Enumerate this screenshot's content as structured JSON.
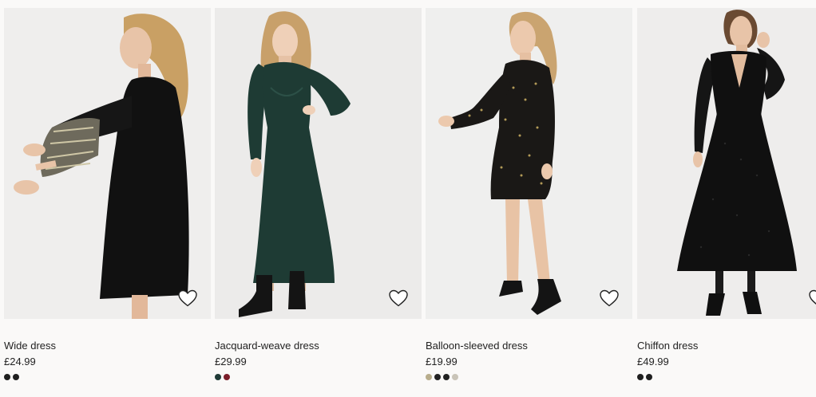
{
  "products": [
    {
      "name": "Wide dress",
      "price": "£24.99",
      "swatches": [
        "#1f1f1f",
        "#1f1f1f"
      ],
      "dress_color": "#111111",
      "bg_color": "#efeeed"
    },
    {
      "name": "Jacquard-weave dress",
      "price": "£29.99",
      "swatches": [
        "#1f3b37",
        "#7b1e2a"
      ],
      "dress_color": "#1e3b34",
      "bg_color": "#ecebea"
    },
    {
      "name": "Balloon-sleeved dress",
      "price": "£19.99",
      "swatches": [
        "#b8ad8c",
        "#222222",
        "#222222",
        "#c9c4b8"
      ],
      "dress_color": "#1a1816",
      "bg_color": "#efefee"
    },
    {
      "name": "Chiffon dress",
      "price": "£49.99",
      "swatches": [
        "#1f1f1f",
        "#1f1f1f"
      ],
      "dress_color": "#101010",
      "bg_color": "#eeedec"
    }
  ],
  "icons": {
    "favorite": "heart-outline-icon"
  }
}
